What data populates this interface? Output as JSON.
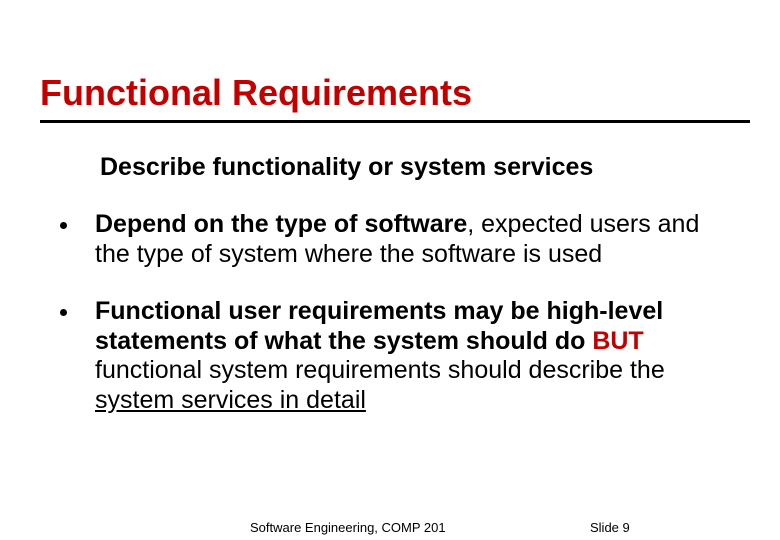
{
  "title": "Functional Requirements",
  "subtitle": "Describe functionality or system services",
  "bullets": [
    {
      "part1_bold": "Depend on the type of software",
      "part2": ", expected users and the type of system where the software is used"
    },
    {
      "p1_bold": "Functional user requirements may be high-level statements of what the system should do ",
      "p2_red": "BUT",
      "p3_plain": " functional system requirements should describe the ",
      "p4_underline": "system services in detail"
    }
  ],
  "footer": {
    "left": "Software Engineering, COMP 201",
    "right_label": "Slide ",
    "right_num": "9"
  }
}
